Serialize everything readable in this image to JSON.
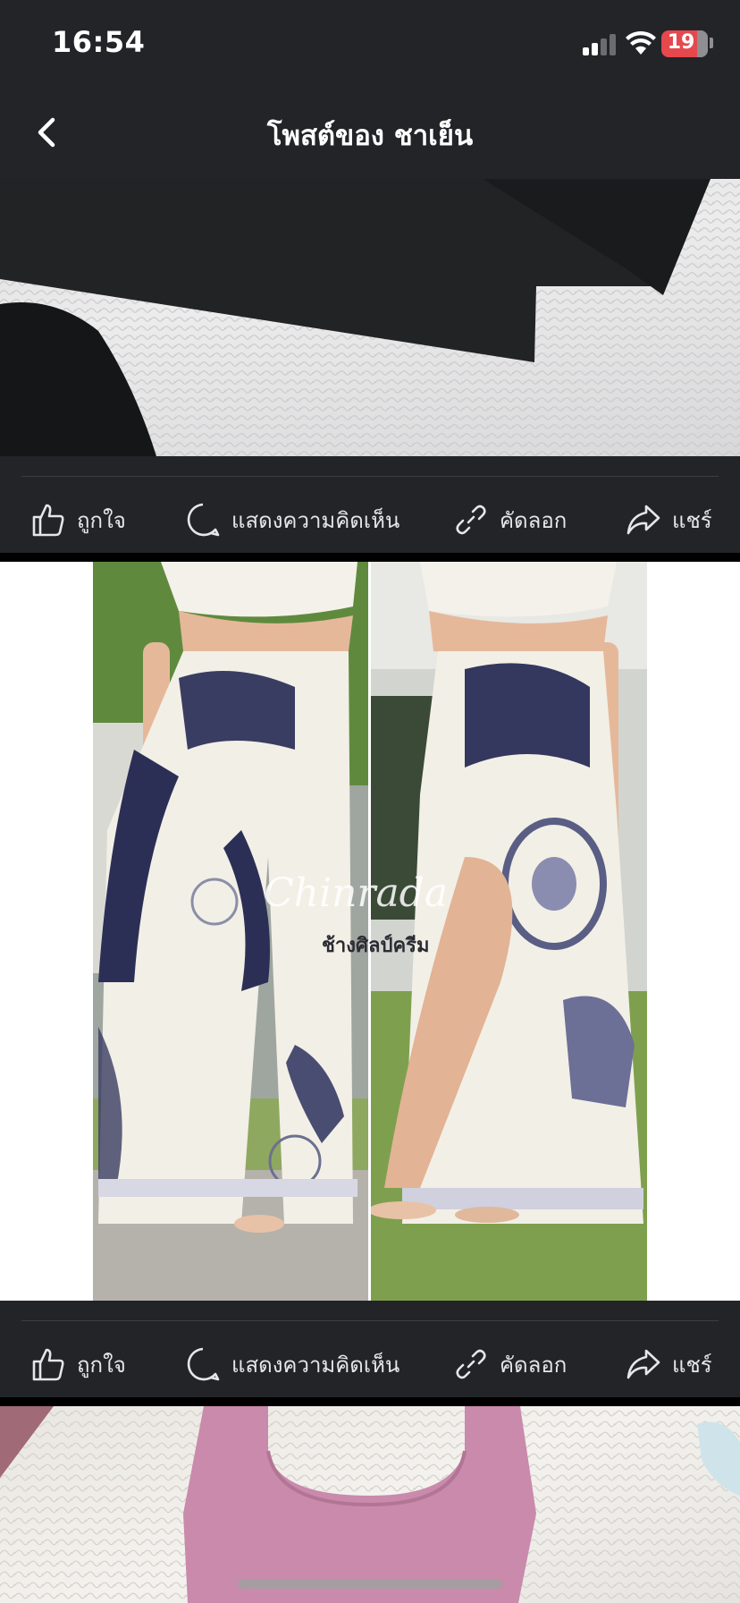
{
  "status_bar": {
    "time": "16:54",
    "battery": "19",
    "battery_color": "#e5484d"
  },
  "header": {
    "title": "โพสต์ของ ชาเย็น",
    "back_icon": "chevron-left-icon"
  },
  "posts": [
    {
      "actions": {
        "like": "ถูกใจ",
        "comment": "แสดงความคิดเห็น",
        "copy": "คัดลอก",
        "share": "แชร์"
      }
    },
    {
      "image_caption": {
        "watermark": "Chinrada",
        "product": "ช้างศิลป์ครีม"
      },
      "actions": {
        "like": "ถูกใจ",
        "comment": "แสดงความคิดเห็น",
        "copy": "คัดลอก",
        "share": "แชร์"
      }
    }
  ],
  "icons": {
    "like": "thumbs-up-icon",
    "comment": "speech-bubble-icon",
    "copy": "link-icon",
    "share": "share-arrow-icon"
  },
  "colors": {
    "app_background": "#1c1d20",
    "bar_background": "#232428",
    "text": "#e4e6eb"
  }
}
